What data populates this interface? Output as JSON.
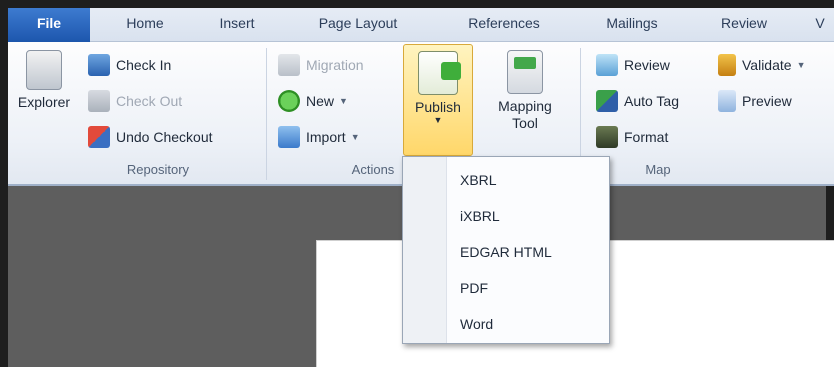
{
  "tabs": [
    "File",
    "Home",
    "Insert",
    "Page Layout",
    "References",
    "Mailings",
    "Review",
    "V"
  ],
  "repository": {
    "label": "Repository",
    "explorer": "Explorer",
    "check_in": "Check In",
    "check_out": "Check Out",
    "undo_checkout": "Undo Checkout"
  },
  "actions": {
    "label": "Actions",
    "migration": "Migration",
    "new": "New",
    "import": "Import",
    "publish": "Publish",
    "mapping_tool_line1": "Mapping",
    "mapping_tool_line2": "Tool"
  },
  "map": {
    "label": "Map",
    "review": "Review",
    "auto_tag": "Auto Tag",
    "format": "Format",
    "validate": "Validate",
    "preview": "Preview"
  },
  "publish_menu": [
    "XBRL",
    "iXBRL",
    "EDGAR HTML",
    "PDF",
    "Word"
  ],
  "colors": {
    "file_tab": "#1d56ad",
    "publish_highlight": "#ffd76a",
    "workspace": "#5e5e5e"
  }
}
